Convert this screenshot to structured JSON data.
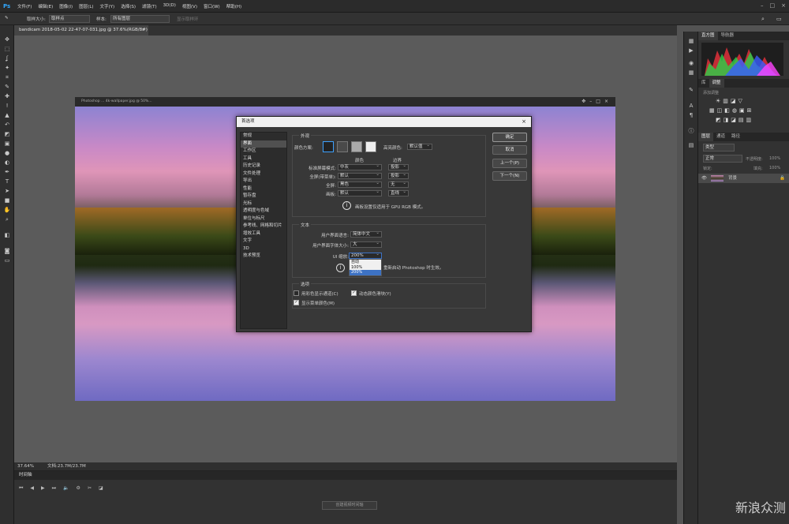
{
  "app": {
    "logo": "Ps",
    "menus": [
      "文件(F)",
      "编辑(E)",
      "图像(I)",
      "图层(L)",
      "文字(Y)",
      "选择(S)",
      "滤镜(T)",
      "3D(D)",
      "视图(V)",
      "窗口(W)",
      "帮助(H)"
    ]
  },
  "options": {
    "sample_size_label": "取样大小:",
    "sample_size_value": "取样点",
    "sample_label": "样本:",
    "sample_value": "所有图层",
    "show_ring": "显示取样环"
  },
  "document": {
    "tab": "bandicam 2018-05-02 22-47-07-031.jpg @ 37.6%(RGB/8#)",
    "inner_title": "Photoshop ... 4k-wallpaper.jpg @ 50%..."
  },
  "status": {
    "zoom": "37.64%",
    "doc": "文档:23.7M/23.7M"
  },
  "timeline": {
    "title": "时间轴",
    "create": "创建视频时间轴"
  },
  "right": {
    "tab_histogram": "直方图",
    "tab_navigator": "导航器",
    "tab_library": "库",
    "tab_adjust": "调整",
    "adjust_add": "添加调整",
    "tab_layers": "图层",
    "tab_channels": "通道",
    "tab_paths": "路径",
    "kind": "类型",
    "blend": "正常",
    "opacity_label": "不透明度:",
    "opacity": "100%",
    "lock_label": "锁定:",
    "fill_label": "填充:",
    "fill": "100%",
    "layer_name": "背景"
  },
  "dialog": {
    "title": "首选项",
    "nav": [
      "常规",
      "界面",
      "工作区",
      "工具",
      "历史记录",
      "文件处理",
      "导出",
      "性能",
      "暂存盘",
      "光标",
      "透明度与色域",
      "单位与标尺",
      "参考线、网格和切片",
      "增效工具",
      "文字",
      "3D",
      "技术预览"
    ],
    "nav_selected": 1,
    "appearance": {
      "title": "外观",
      "color_theme": "颜色方案:",
      "highlight_label": "高亮颜色:",
      "highlight_value": "默认值",
      "col_color": "颜色",
      "col_border": "边界",
      "rows": [
        {
          "label": "标准屏幕模式:",
          "color": "中灰",
          "border": "投影"
        },
        {
          "label": "全屏(带菜单):",
          "color": "默认",
          "border": "投影"
        },
        {
          "label": "全屏:",
          "color": "黑色",
          "border": "无"
        },
        {
          "label": "画板:",
          "color": "默认",
          "border": "直线"
        }
      ],
      "note": "画板设置仅适用于 GPU RGB 模式。"
    },
    "text": {
      "title": "文本",
      "ui_lang_label": "用户界面语言:",
      "ui_lang": "简体中文",
      "ui_font_label": "用户界面字体大小:",
      "ui_font": "大",
      "scale_label": "UI 缩放:",
      "scale": "200%",
      "note": "重新启动 Photoshop 时生效。",
      "options": [
        "自动",
        "100%",
        "200%"
      ],
      "option_selected": 2
    },
    "options": {
      "title": "选项",
      "color_channels": "用彩色显示通道(C)",
      "dynamic_sliders": "动态颜色滑块(Y)",
      "menu_colors": "显示菜单颜色(M)"
    },
    "buttons": {
      "ok": "确定",
      "cancel": "取消",
      "prev": "上一个(P)",
      "next": "下一个(N)"
    }
  },
  "watermark": "新浪众测"
}
